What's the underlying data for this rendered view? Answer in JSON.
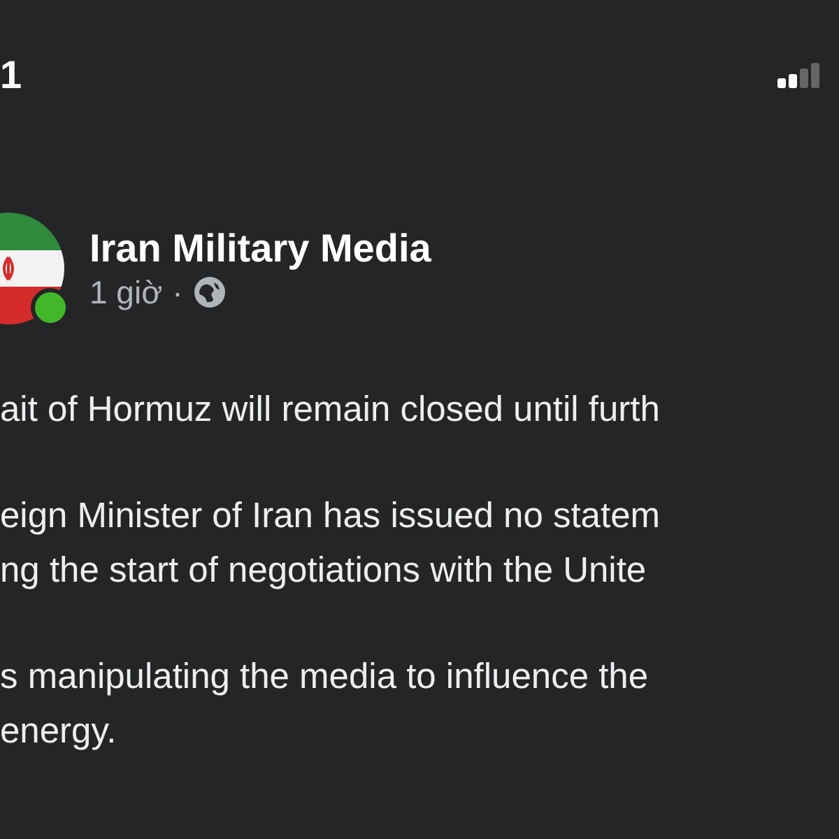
{
  "status_bar": {
    "time": "1"
  },
  "post": {
    "author": "Iran Military Media",
    "time": "1 giờ",
    "separator": "·",
    "online": true
  },
  "paragraphs": [
    {
      "lines": [
        "ait of Hormuz will remain closed until furth"
      ]
    },
    {
      "lines": [
        "eign Minister of Iran has issued no statem",
        "ng the start of negotiations with the Unite"
      ]
    },
    {
      "lines": [
        "s manipulating the media to influence the",
        "energy."
      ]
    }
  ]
}
